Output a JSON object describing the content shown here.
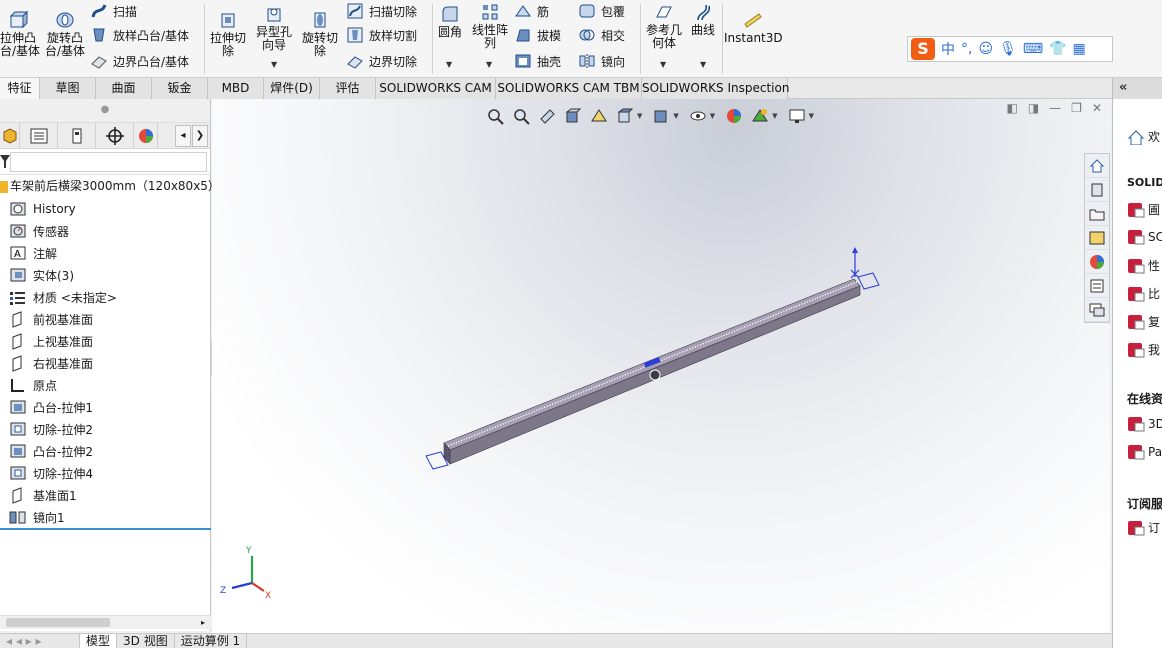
{
  "ribbon": {
    "extrude_boss": "拉伸凸\n台/基体",
    "revolve_boss": "旋转凸\n台/基体",
    "sweep": "扫描",
    "loft_boss": "放样凸台/基体",
    "boundary_boss": "边界凸台/基体",
    "extrude_cut": "拉伸切\n除",
    "hole_wizard": "异型孔\n向导",
    "revolve_cut": "旋转切\n除",
    "swept_cut": "扫描切除",
    "lofted_cut": "放样切割",
    "boundary_cut": "边界切除",
    "fillet": "圆角",
    "linear_pattern": "线性阵\n列",
    "rib": "筋",
    "draft": "拔模",
    "shell": "抽壳",
    "wrap": "包覆",
    "intersect": "相交",
    "mirror": "镜向",
    "ref_geometry": "参考几\n何体",
    "curves": "曲线",
    "instant3d": "Instant3D"
  },
  "ime": {
    "mode": "中"
  },
  "tabs": [
    {
      "label": "特征",
      "active": true
    },
    {
      "label": "草图",
      "active": false
    },
    {
      "label": "曲面",
      "active": false
    },
    {
      "label": "钣金",
      "active": false
    },
    {
      "label": "MBD",
      "active": false
    },
    {
      "label": "焊件(D)",
      "active": false
    },
    {
      "label": "评估",
      "active": false
    },
    {
      "label": "SOLIDWORKS CAM",
      "active": false
    },
    {
      "label": "SOLIDWORKS CAM TBM",
      "active": false
    },
    {
      "label": "SOLIDWORKS Inspection",
      "active": false
    }
  ],
  "tree": {
    "root": "车架前后横梁3000mm（120x80x5）",
    "items": [
      {
        "label": "History",
        "icon": "history-icon"
      },
      {
        "label": "传感器",
        "icon": "sensor-icon"
      },
      {
        "label": "注解",
        "icon": "annotation-icon"
      },
      {
        "label": "实体(3)",
        "icon": "solid-bodies-icon"
      },
      {
        "label": "材质 <未指定>",
        "icon": "material-icon"
      },
      {
        "label": "前视基准面",
        "icon": "plane-icon"
      },
      {
        "label": "上视基准面",
        "icon": "plane-icon"
      },
      {
        "label": "右视基准面",
        "icon": "plane-icon"
      },
      {
        "label": "原点",
        "icon": "origin-icon"
      },
      {
        "label": "凸台-拉伸1",
        "icon": "extrude-icon"
      },
      {
        "label": "切除-拉伸2",
        "icon": "cut-icon"
      },
      {
        "label": "凸台-拉伸2",
        "icon": "extrude-icon"
      },
      {
        "label": "切除-拉伸4",
        "icon": "cut-icon"
      },
      {
        "label": "基准面1",
        "icon": "plane-icon"
      },
      {
        "label": "镜向1",
        "icon": "mirror-icon"
      }
    ]
  },
  "rightpane": {
    "heading": "欢",
    "section1": "SOLIDW",
    "items1": [
      "圃",
      "SC",
      "性",
      "比",
      "复",
      "我"
    ],
    "section2": "在线资",
    "items2": [
      "3D",
      "Pa"
    ],
    "section3": "订阅服",
    "items3": [
      "订"
    ]
  },
  "triad": {
    "x": "X",
    "y": "Y",
    "z": "Z"
  },
  "bottom_tabs": [
    {
      "label": "模型",
      "active": true
    },
    {
      "label": "3D 视图",
      "active": false
    },
    {
      "label": "运动算例 1",
      "active": false
    }
  ],
  "colors": {
    "accent": "#3c8fd2",
    "beam": "#7e7689",
    "ime_brand": "#f25d14"
  }
}
